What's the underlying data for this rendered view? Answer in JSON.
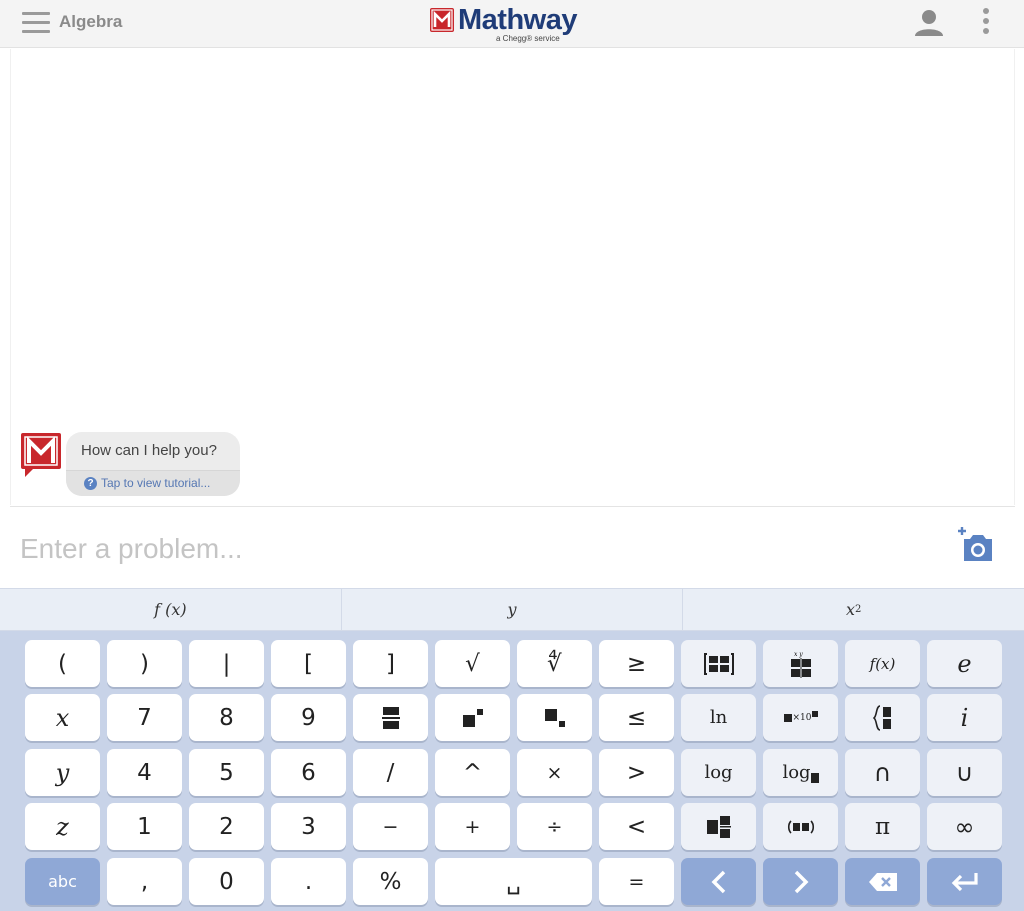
{
  "header": {
    "subject": "Algebra",
    "brand": "Mathway",
    "brand_sub": "a Chegg® service"
  },
  "chat": {
    "greeting": "How can I help you?",
    "tutorial_link": "Tap to view tutorial..."
  },
  "input": {
    "placeholder": "Enter a problem..."
  },
  "keyboard": {
    "tabs": [
      {
        "label": "f (x)"
      },
      {
        "label": "y"
      },
      {
        "label": "x",
        "sup": "2"
      }
    ],
    "keys": {
      "open_paren": "(",
      "close_paren": ")",
      "abs": "|",
      "open_bracket": "[",
      "close_bracket": "]",
      "sqrt": "√",
      "nth_root": "∜",
      "geq": "≥",
      "fx": "f(x)",
      "e": "e",
      "x": "x",
      "seven": "7",
      "eight": "8",
      "nine": "9",
      "leq": "≤",
      "ln": "ln",
      "times_ten": "×10",
      "i": "i",
      "y": "y",
      "four": "4",
      "five": "5",
      "six": "6",
      "slash": "/",
      "caret": "^",
      "times": "×",
      "gt": ">",
      "log": "log",
      "log_base": "log",
      "intersect": "∩",
      "union": "∪",
      "z": "z",
      "one": "1",
      "two": "2",
      "three": "3",
      "minus": "−",
      "plus": "+",
      "divide": "÷",
      "lt": "<",
      "pi": "π",
      "infinity": "∞",
      "abc": "abc",
      "comma": ",",
      "zero": "0",
      "period": ".",
      "percent": "%",
      "space": "␣",
      "equals": "="
    }
  }
}
